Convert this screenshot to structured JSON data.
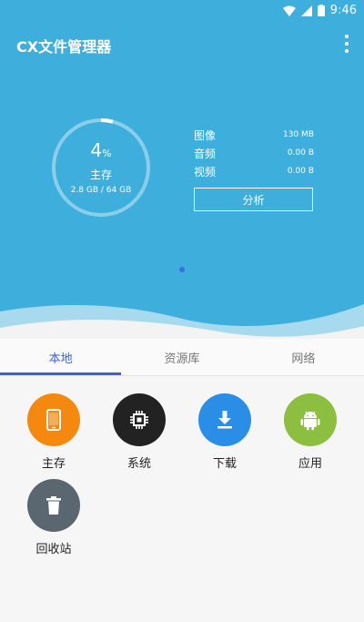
{
  "status_bar": {
    "time": "9:46"
  },
  "header": {
    "title": "CX文件管理器"
  },
  "storage": {
    "percent": "4",
    "percent_unit": "%",
    "percent_value": 4,
    "label": "主存",
    "size": "2.8 GB / 64 GB"
  },
  "stats": [
    {
      "label": "图像",
      "value": "130 MB"
    },
    {
      "label": "音频",
      "value": "0.00 B"
    },
    {
      "label": "视频",
      "value": "0.00 B"
    }
  ],
  "analyze_label": "分析",
  "tabs": [
    {
      "label": "本地",
      "active": true
    },
    {
      "label": "资源库",
      "active": false
    },
    {
      "label": "网络",
      "active": false
    }
  ],
  "items": [
    {
      "label": "主存",
      "icon": "phone-icon",
      "color": "#f5890f"
    },
    {
      "label": "系统",
      "icon": "chip-icon",
      "color": "#222222"
    },
    {
      "label": "下载",
      "icon": "download-icon",
      "color": "#2a8ee6"
    },
    {
      "label": "应用",
      "icon": "android-icon",
      "color": "#8cbf3f"
    },
    {
      "label": "回收站",
      "icon": "trash-icon",
      "color": "#5a6670"
    }
  ],
  "colors": {
    "header_bg": "#3eaedc",
    "accent": "#3f63d6"
  }
}
